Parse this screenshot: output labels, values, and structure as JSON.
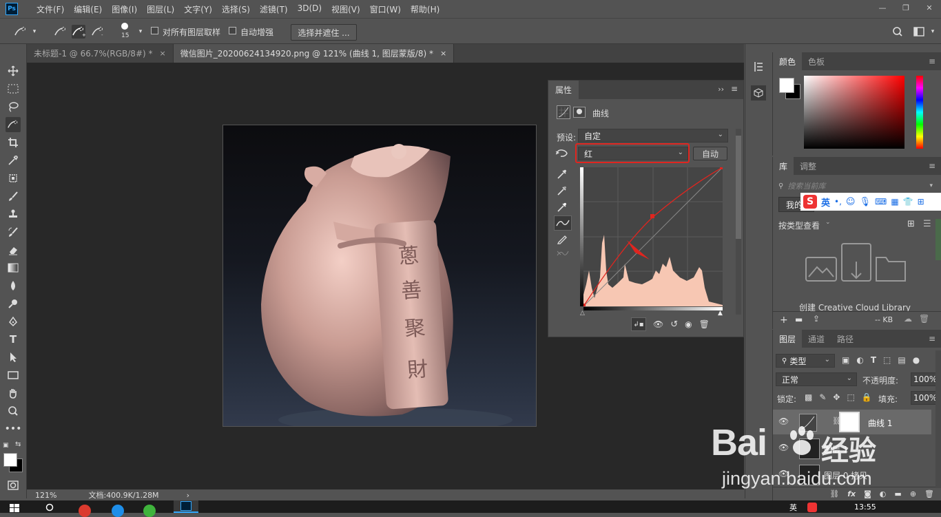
{
  "app": {
    "logo": "Ps"
  },
  "menu": [
    "文件(F)",
    "编辑(E)",
    "图像(I)",
    "图层(L)",
    "文字(Y)",
    "选择(S)",
    "滤镜(T)",
    "3D(D)",
    "视图(V)",
    "窗口(W)",
    "帮助(H)"
  ],
  "window_controls": {
    "minimize": "—",
    "restore": "❐",
    "close": "✕"
  },
  "options": {
    "brush_size": "15",
    "sample_all_layers": "对所有图层取样",
    "auto_enhance": "自动增强",
    "select_and_mask": "选择并遮住 ..."
  },
  "tabs": [
    {
      "label": "未标题-1 @ 66.7%(RGB/8#) *",
      "close": "×"
    },
    {
      "label": "微信图片_20200624134920.png @ 121% (曲线 1, 图层蒙版/8) *",
      "close": "×"
    }
  ],
  "status": {
    "zoom": "121%",
    "doc": "文档:400.9K/1.28M",
    "arrow": "›"
  },
  "properties": {
    "tab": "属性",
    "title": "曲线",
    "preset_label": "预设:",
    "preset_value": "自定",
    "channel_value": "红",
    "auto_button": "自动"
  },
  "image": {
    "seal_chars": [
      "蔥",
      "善",
      "聚",
      "財"
    ]
  },
  "color_panel": {
    "tabs": [
      "颜色",
      "色板"
    ]
  },
  "library_panel": {
    "tabs": [
      "库",
      "调整"
    ],
    "search_placeholder": "搜索当前库",
    "my_library": "我的",
    "ime": "英",
    "view_by": "按类型查看",
    "create": "创建 Creative Cloud Library",
    "size": "-- KB"
  },
  "layers_panel": {
    "tabs": [
      "图层",
      "通道",
      "路径"
    ],
    "filter": "类型",
    "blend_mode": "正常",
    "opacity_label": "不透明度:",
    "opacity_value": "100%",
    "lock_label": "锁定:",
    "fill_label": "填充:",
    "fill_value": "100%",
    "layers": [
      {
        "name": "曲线 1"
      },
      {
        "name": "图层 1"
      },
      {
        "name": "图层 0 拷贝"
      }
    ]
  },
  "watermark": {
    "brand": "Bai",
    "brand_cn": "经验",
    "url": "jingyan.baidu.com"
  },
  "taskbar": {
    "time": "13:55",
    "tray_text": "英"
  },
  "colors": {
    "accent_red": "#e0251f",
    "panel_bg": "#535353",
    "dark_bg": "#282828",
    "ps_blue": "#31a8ff"
  }
}
